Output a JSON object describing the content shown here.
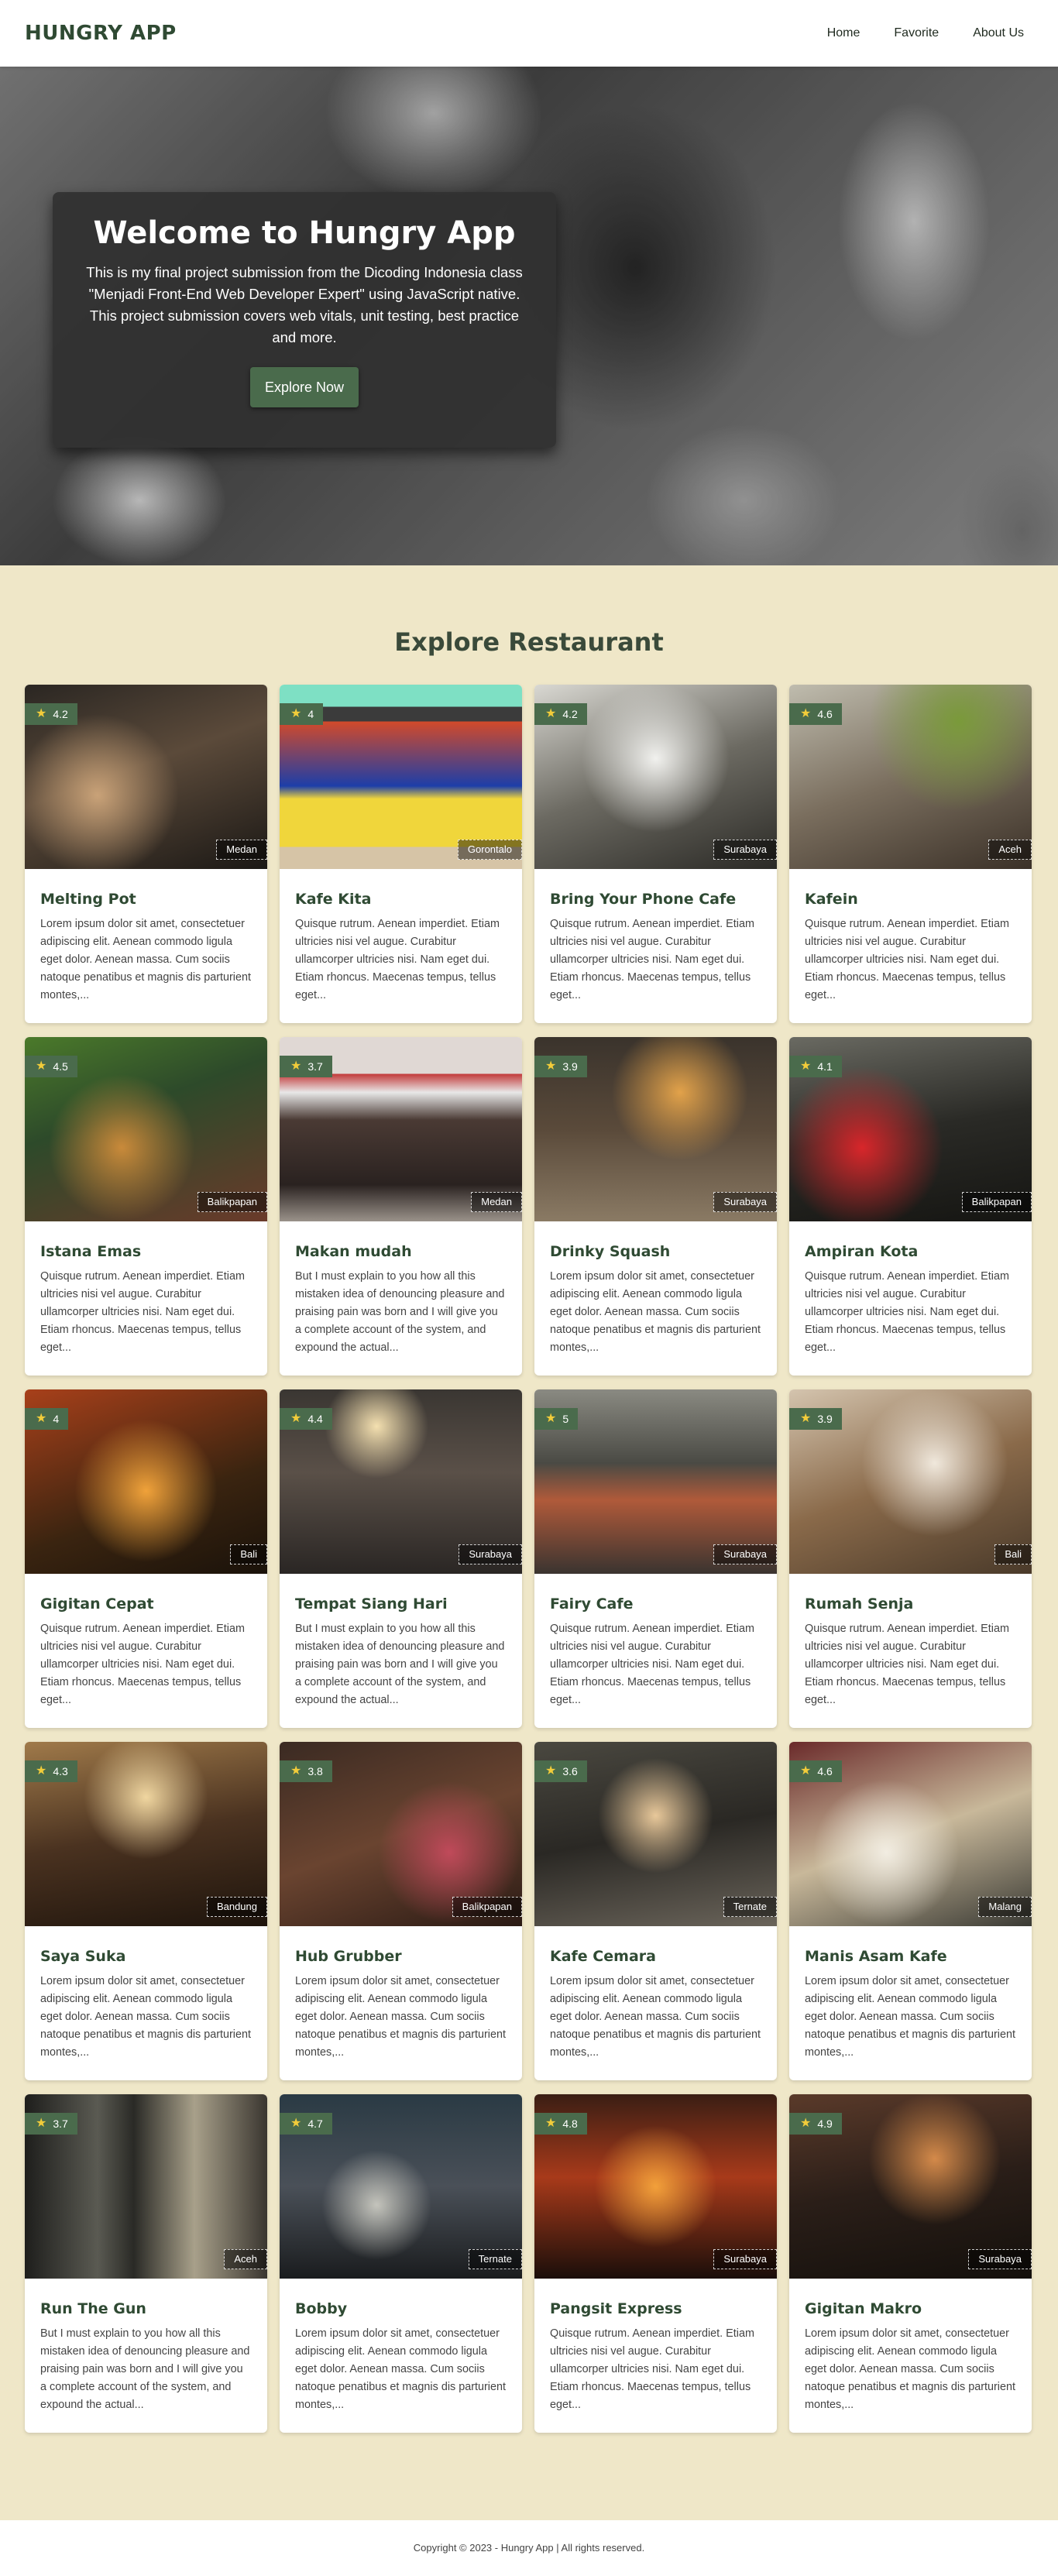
{
  "header": {
    "brand": "HUNGRY APP",
    "nav": [
      {
        "label": "Home"
      },
      {
        "label": "Favorite"
      },
      {
        "label": "About Us"
      }
    ]
  },
  "hero": {
    "title": "Welcome to Hungry App",
    "description": "This is my final project submission from the Dicoding Indonesia class \"Menjadi Front-End Web Developer Expert\" using JavaScript native. This project submission covers web vitals, unit testing, best practice and more.",
    "button_label": "Explore Now"
  },
  "explore": {
    "title": "Explore Restaurant"
  },
  "restaurants": [
    {
      "name": "Melting Pot",
      "rating": "4.2",
      "city": "Medan",
      "description": "Lorem ipsum dolor sit amet, consectetuer adipiscing elit. Aenean commodo ligula eget dolor. Aenean massa. Cum sociis natoque penatibus et magnis dis parturient montes,..."
    },
    {
      "name": "Kafe Kita",
      "rating": "4",
      "city": "Gorontalo",
      "description": "Quisque rutrum. Aenean imperdiet. Etiam ultricies nisi vel augue. Curabitur ullamcorper ultricies nisi. Nam eget dui. Etiam rhoncus. Maecenas tempus, tellus eget..."
    },
    {
      "name": "Bring Your Phone Cafe",
      "rating": "4.2",
      "city": "Surabaya",
      "description": "Quisque rutrum. Aenean imperdiet. Etiam ultricies nisi vel augue. Curabitur ullamcorper ultricies nisi. Nam eget dui. Etiam rhoncus. Maecenas tempus, tellus eget..."
    },
    {
      "name": "Kafein",
      "rating": "4.6",
      "city": "Aceh",
      "description": "Quisque rutrum. Aenean imperdiet. Etiam ultricies nisi vel augue. Curabitur ullamcorper ultricies nisi. Nam eget dui. Etiam rhoncus. Maecenas tempus, tellus eget..."
    },
    {
      "name": "Istana Emas",
      "rating": "4.5",
      "city": "Balikpapan",
      "description": "Quisque rutrum. Aenean imperdiet. Etiam ultricies nisi vel augue. Curabitur ullamcorper ultricies nisi. Nam eget dui. Etiam rhoncus. Maecenas tempus, tellus eget..."
    },
    {
      "name": "Makan mudah",
      "rating": "3.7",
      "city": "Medan",
      "description": "But I must explain to you how all this mistaken idea of denouncing pleasure and praising pain was born and I will give you a complete account of the system, and expound the actual..."
    },
    {
      "name": "Drinky Squash",
      "rating": "3.9",
      "city": "Surabaya",
      "description": "Lorem ipsum dolor sit amet, consectetuer adipiscing elit. Aenean commodo ligula eget dolor. Aenean massa. Cum sociis natoque penatibus et magnis dis parturient montes,..."
    },
    {
      "name": "Ampiran Kota",
      "rating": "4.1",
      "city": "Balikpapan",
      "description": "Quisque rutrum. Aenean imperdiet. Etiam ultricies nisi vel augue. Curabitur ullamcorper ultricies nisi. Nam eget dui. Etiam rhoncus. Maecenas tempus, tellus eget..."
    },
    {
      "name": "Gigitan Cepat",
      "rating": "4",
      "city": "Bali",
      "description": "Quisque rutrum. Aenean imperdiet. Etiam ultricies nisi vel augue. Curabitur ullamcorper ultricies nisi. Nam eget dui. Etiam rhoncus. Maecenas tempus, tellus eget..."
    },
    {
      "name": "Tempat Siang Hari",
      "rating": "4.4",
      "city": "Surabaya",
      "description": "But I must explain to you how all this mistaken idea of denouncing pleasure and praising pain was born and I will give you a complete account of the system, and expound the actual..."
    },
    {
      "name": "Fairy Cafe",
      "rating": "5",
      "city": "Surabaya",
      "description": "Quisque rutrum. Aenean imperdiet. Etiam ultricies nisi vel augue. Curabitur ullamcorper ultricies nisi. Nam eget dui. Etiam rhoncus. Maecenas tempus, tellus eget..."
    },
    {
      "name": "Rumah Senja",
      "rating": "3.9",
      "city": "Bali",
      "description": "Quisque rutrum. Aenean imperdiet. Etiam ultricies nisi vel augue. Curabitur ullamcorper ultricies nisi. Nam eget dui. Etiam rhoncus. Maecenas tempus, tellus eget..."
    },
    {
      "name": "Saya Suka",
      "rating": "4.3",
      "city": "Bandung",
      "description": "Lorem ipsum dolor sit amet, consectetuer adipiscing elit. Aenean commodo ligula eget dolor. Aenean massa. Cum sociis natoque penatibus et magnis dis parturient montes,..."
    },
    {
      "name": "Hub Grubber",
      "rating": "3.8",
      "city": "Balikpapan",
      "description": "Lorem ipsum dolor sit amet, consectetuer adipiscing elit. Aenean commodo ligula eget dolor. Aenean massa. Cum sociis natoque penatibus et magnis dis parturient montes,..."
    },
    {
      "name": "Kafe Cemara",
      "rating": "3.6",
      "city": "Ternate",
      "description": "Lorem ipsum dolor sit amet, consectetuer adipiscing elit. Aenean commodo ligula eget dolor. Aenean massa. Cum sociis natoque penatibus et magnis dis parturient montes,..."
    },
    {
      "name": "Manis Asam Kafe",
      "rating": "4.6",
      "city": "Malang",
      "description": "Lorem ipsum dolor sit amet, consectetuer adipiscing elit. Aenean commodo ligula eget dolor. Aenean massa. Cum sociis natoque penatibus et magnis dis parturient montes,..."
    },
    {
      "name": "Run The Gun",
      "rating": "3.7",
      "city": "Aceh",
      "description": "But I must explain to you how all this mistaken idea of denouncing pleasure and praising pain was born and I will give you a complete account of the system, and expound the actual..."
    },
    {
      "name": "Bobby",
      "rating": "4.7",
      "city": "Ternate",
      "description": "Lorem ipsum dolor sit amet, consectetuer adipiscing elit. Aenean commodo ligula eget dolor. Aenean massa. Cum sociis natoque penatibus et magnis dis parturient montes,..."
    },
    {
      "name": "Pangsit Express",
      "rating": "4.8",
      "city": "Surabaya",
      "description": "Quisque rutrum. Aenean imperdiet. Etiam ultricies nisi vel augue. Curabitur ullamcorper ultricies nisi. Nam eget dui. Etiam rhoncus. Maecenas tempus, tellus eget..."
    },
    {
      "name": "Gigitan Makro",
      "rating": "4.9",
      "city": "Surabaya",
      "description": "Lorem ipsum dolor sit amet, consectetuer adipiscing elit. Aenean commodo ligula eget dolor. Aenean massa. Cum sociis natoque penatibus et magnis dis parturient montes,..."
    }
  ],
  "footer": {
    "copyright": "Copyright © 2023 - Hungry App | All rights reserved."
  },
  "colors": {
    "primary": "#4a6b4c",
    "brand_text": "#2f4a33",
    "background": "#efe7c8",
    "star": "#f2cc3a"
  },
  "icons": {
    "rating": "star-icon"
  }
}
